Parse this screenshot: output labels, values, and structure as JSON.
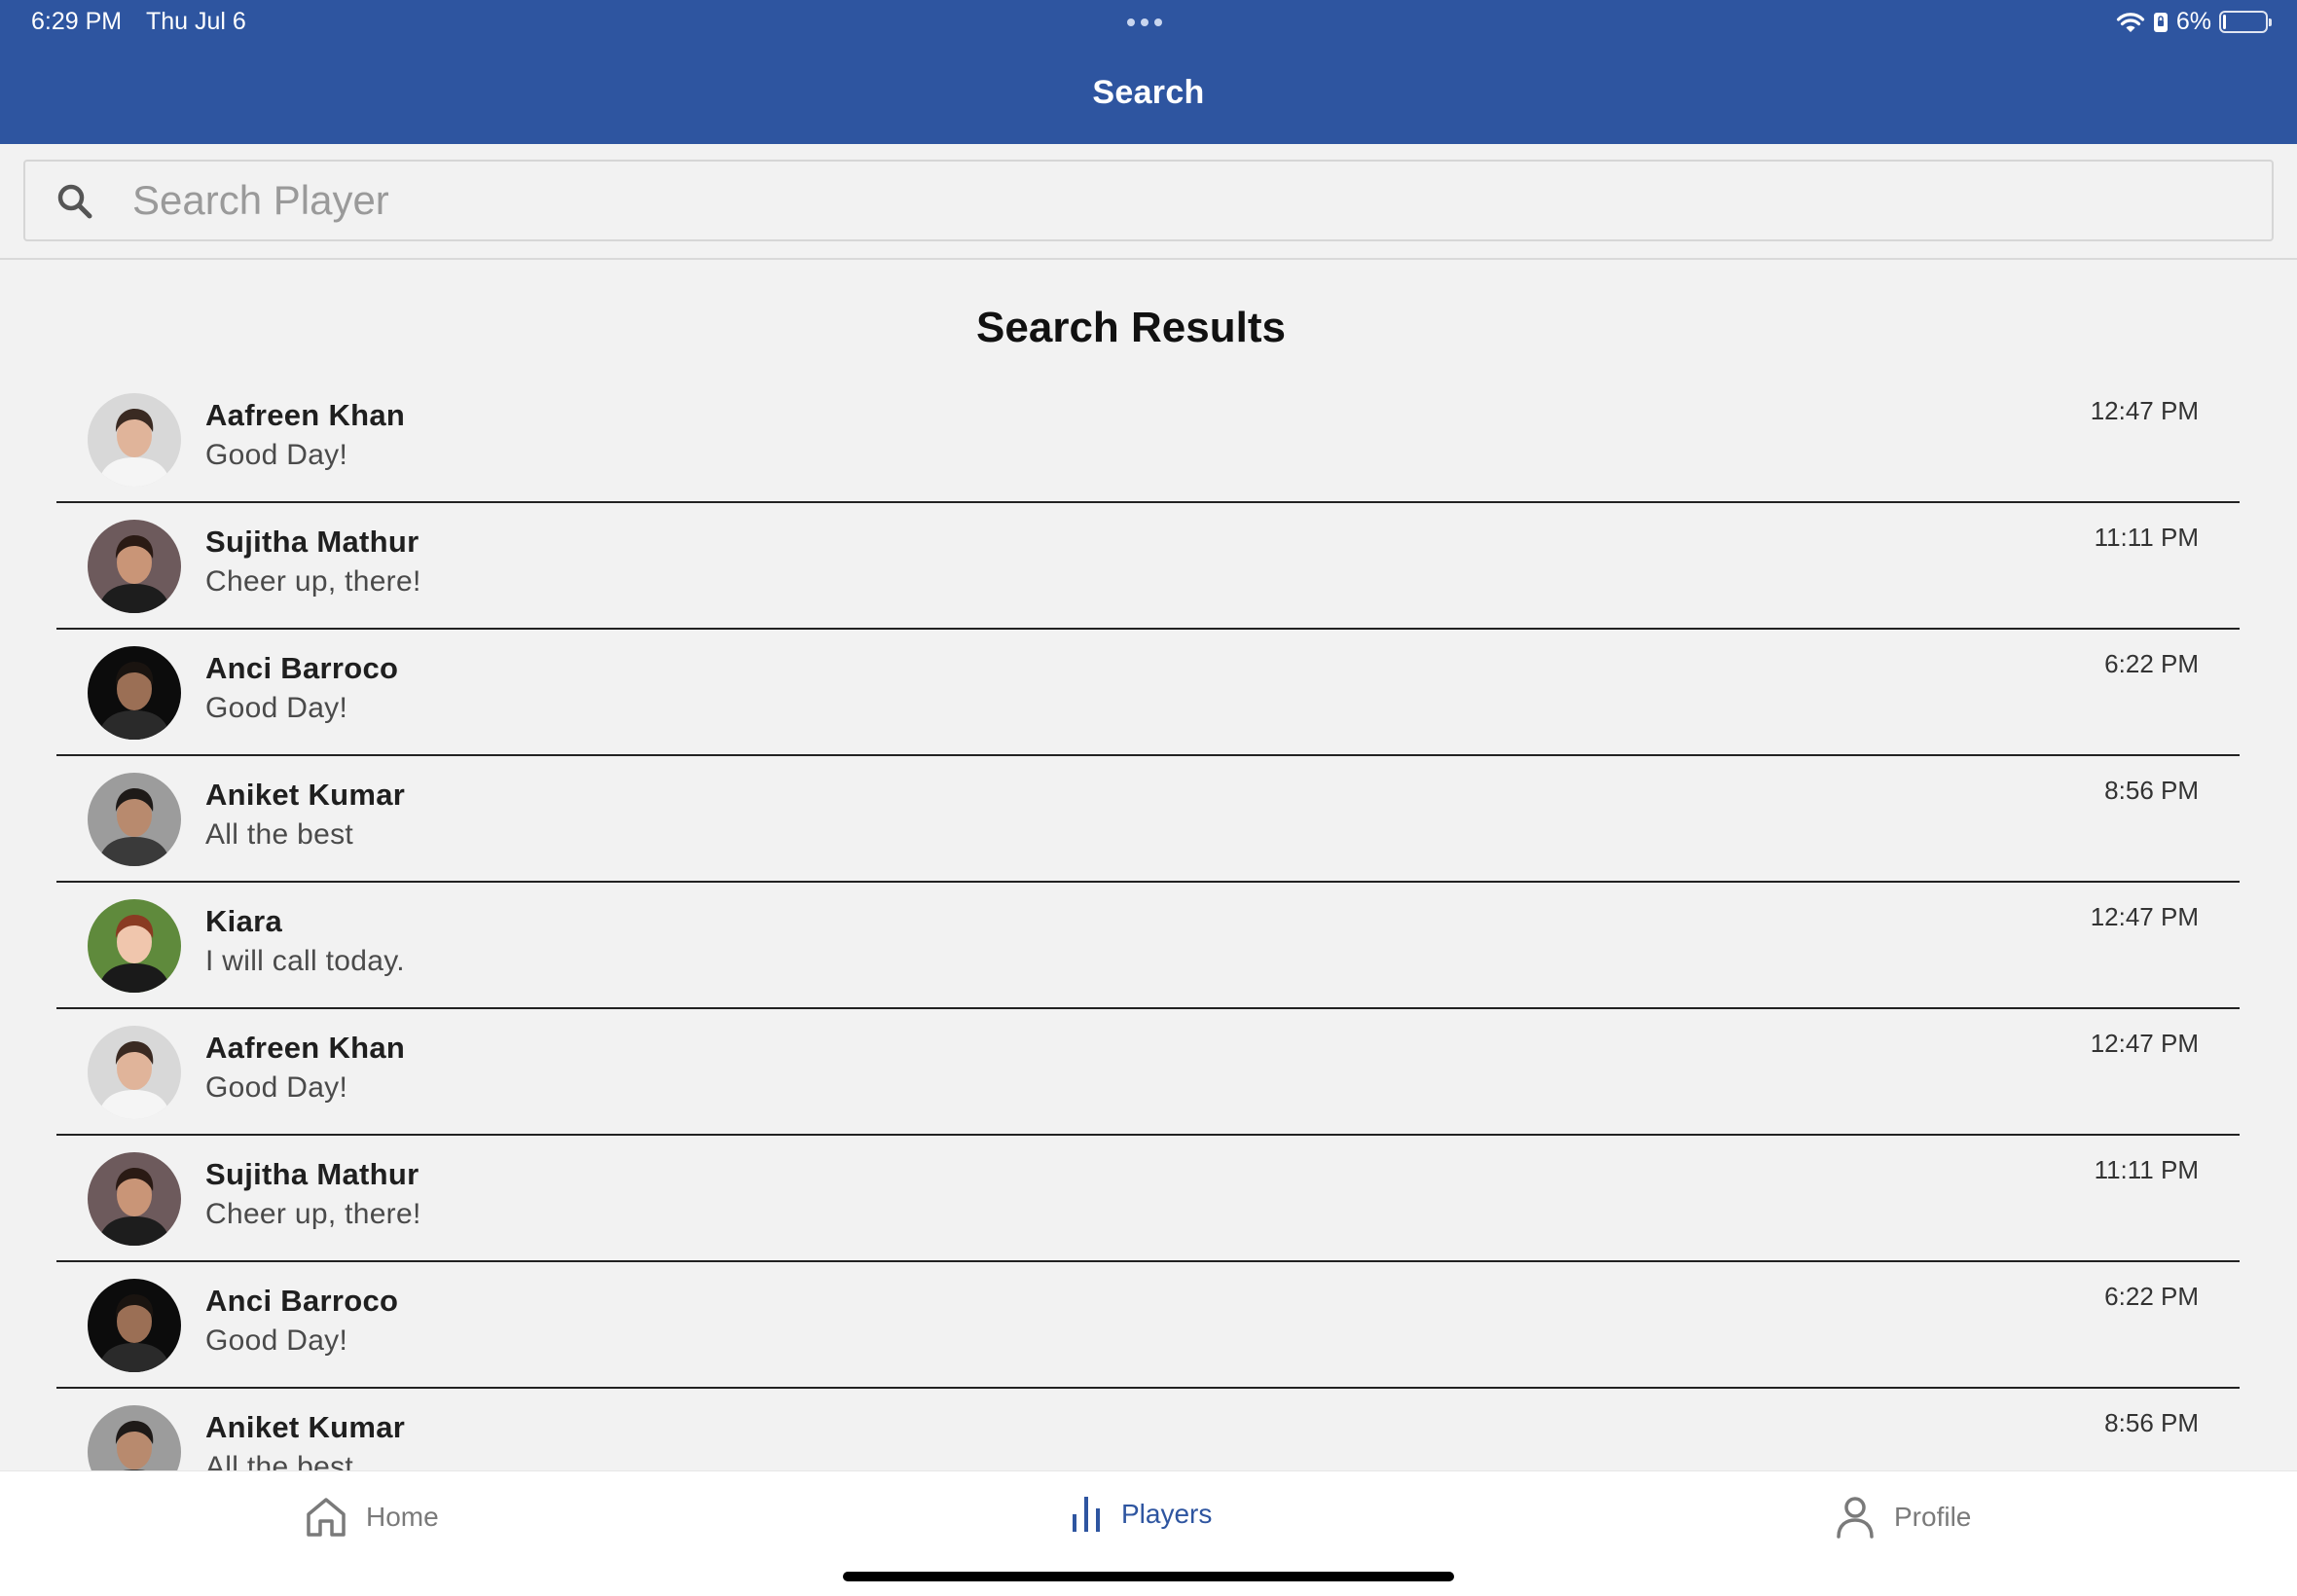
{
  "status_bar": {
    "time": "6:29 PM",
    "date": "Thu Jul 6",
    "battery_text": "6%",
    "battery_level": 0.06
  },
  "header": {
    "title": "Search"
  },
  "search": {
    "placeholder": "Search Player",
    "value": ""
  },
  "results": {
    "title": "Search Results",
    "items": [
      {
        "name": "Aafreen Khan",
        "message": "Good Day!",
        "time": "12:47 PM"
      },
      {
        "name": "Sujitha Mathur",
        "message": "Cheer up, there!",
        "time": "11:11 PM"
      },
      {
        "name": "Anci Barroco",
        "message": "Good Day!",
        "time": "6:22 PM"
      },
      {
        "name": "Aniket Kumar",
        "message": "All the best",
        "time": "8:56 PM"
      },
      {
        "name": "Kiara",
        "message": "I will call today.",
        "time": "12:47 PM"
      },
      {
        "name": "Aafreen Khan",
        "message": "Good Day!",
        "time": "12:47 PM"
      },
      {
        "name": "Sujitha Mathur",
        "message": "Cheer up, there!",
        "time": "11:11 PM"
      },
      {
        "name": "Anci Barroco",
        "message": "Good Day!",
        "time": "6:22 PM"
      },
      {
        "name": "Aniket Kumar",
        "message": "All the best",
        "time": "8:56 PM"
      }
    ]
  },
  "tab_bar": {
    "tabs": [
      {
        "label": "Home",
        "icon": "home-icon",
        "active": false
      },
      {
        "label": "Players",
        "icon": "bar-chart-icon",
        "active": true
      },
      {
        "label": "Profile",
        "icon": "person-icon",
        "active": false
      }
    ]
  },
  "colors": {
    "header_bg": "#2e55a0",
    "active_tab": "#2e55a0",
    "page_bg": "#f2f2f2"
  }
}
